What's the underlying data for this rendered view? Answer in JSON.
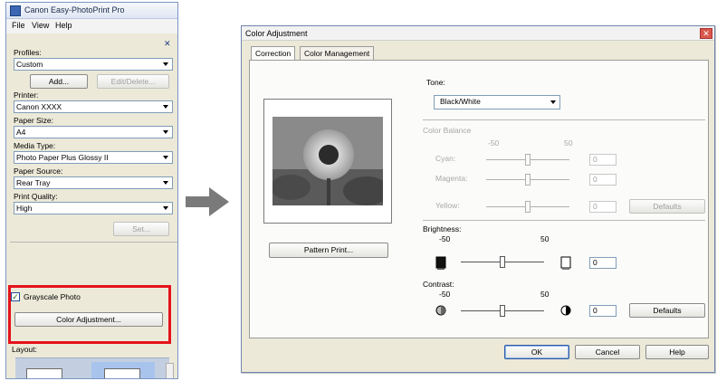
{
  "left_panel": {
    "title": "Canon Easy-PhotoPrint Pro",
    "menu": [
      "File",
      "View",
      "Help"
    ],
    "profiles_label": "Profiles:",
    "profiles_value": "Custom",
    "add_button": "Add...",
    "edit_delete_button": "Edit/Delete...",
    "printer_label": "Printer:",
    "printer_value": "Canon XXXX",
    "paper_size_label": "Paper Size:",
    "paper_size_value": "A4",
    "media_type_label": "Media Type:",
    "media_type_value": "Photo Paper Plus Glossy II",
    "paper_source_label": "Paper Source:",
    "paper_source_value": "Rear Tray",
    "print_quality_label": "Print Quality:",
    "print_quality_value": "High",
    "set_button": "Set...",
    "grayscale_label": "Grayscale Photo",
    "grayscale_checked": true,
    "color_adjustment_button": "Color Adjustment...",
    "layout_label": "Layout:"
  },
  "dialog": {
    "title": "Color Adjustment",
    "tabs": [
      "Correction",
      "Color Management"
    ],
    "tone_label": "Tone:",
    "tone_value": "Black/White",
    "color_balance_label": "Color Balance",
    "cb_min": "-50",
    "cb_max": "50",
    "cyan_label": "Cyan:",
    "cyan_value": "0",
    "magenta_label": "Magenta:",
    "magenta_value": "0",
    "yellow_label": "Yellow:",
    "yellow_value": "0",
    "defaults_button": "Defaults",
    "brightness_label": "Brightness:",
    "brightness_min": "-50",
    "brightness_max": "50",
    "brightness_value": "0",
    "contrast_label": "Contrast:",
    "contrast_min": "-50",
    "contrast_max": "50",
    "contrast_value": "0",
    "pattern_print_button": "Pattern Print...",
    "ok_button": "OK",
    "cancel_button": "Cancel",
    "help_button": "Help"
  },
  "colors": {
    "highlight": "#e4121b",
    "arrow": "#7a7a7a"
  }
}
